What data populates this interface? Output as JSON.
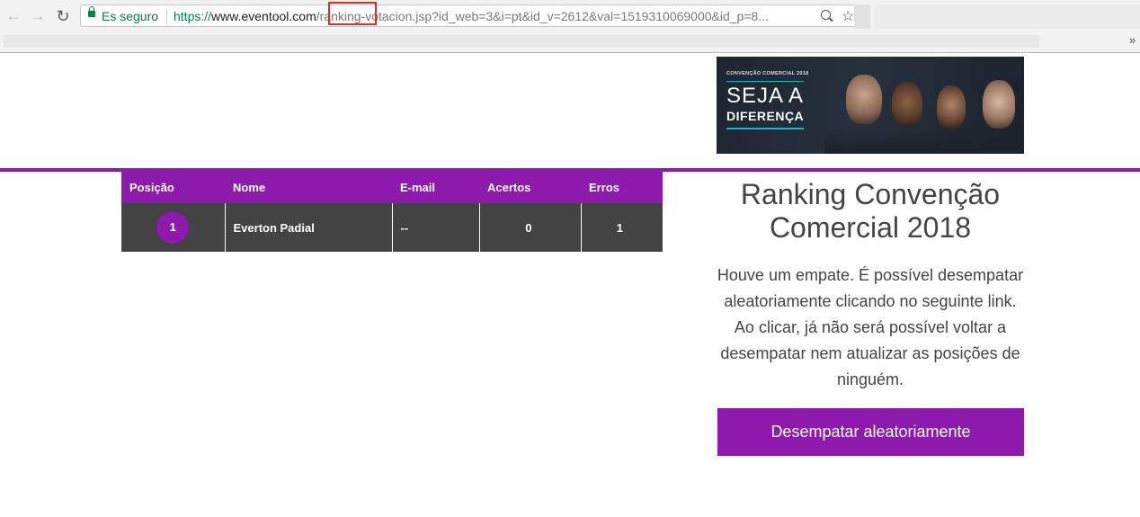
{
  "browser": {
    "security_label": "Es seguro",
    "url_scheme": "https://",
    "url_host": "www.eventool.com",
    "url_path": "/ranking-votacion.jsp?id_web=3&i=pt&id_v=2612&val=1519310069000&id_p=8...",
    "bookmarks_overflow": "»"
  },
  "banner": {
    "eyebrow": "CONVENÇÃO COMERCIAL 2018",
    "headline_line1": "SEJA A",
    "headline_line2": "DIFERENÇA"
  },
  "ranking_table": {
    "headers": [
      "Posição",
      "Nome",
      "E-mail",
      "Acertos",
      "Erros"
    ],
    "rows": [
      {
        "position": "1",
        "name": "Everton Padial",
        "email": "--",
        "hits": "0",
        "errors": "1"
      }
    ]
  },
  "sidebar": {
    "title": "Ranking Convenção Comercial 2018",
    "message": "Houve um empate. É possível desempatar aleatoriamente clicando no seguinte link. Ao clicar, já não será possível voltar a desempatar nem atualizar as posições de ninguém.",
    "button_label": "Desempatar aleatoriamente"
  },
  "colors": {
    "accent": "#8e1aad",
    "table_body": "#434343",
    "secure_green": "#0b8043",
    "url_highlight": "#d93025"
  }
}
